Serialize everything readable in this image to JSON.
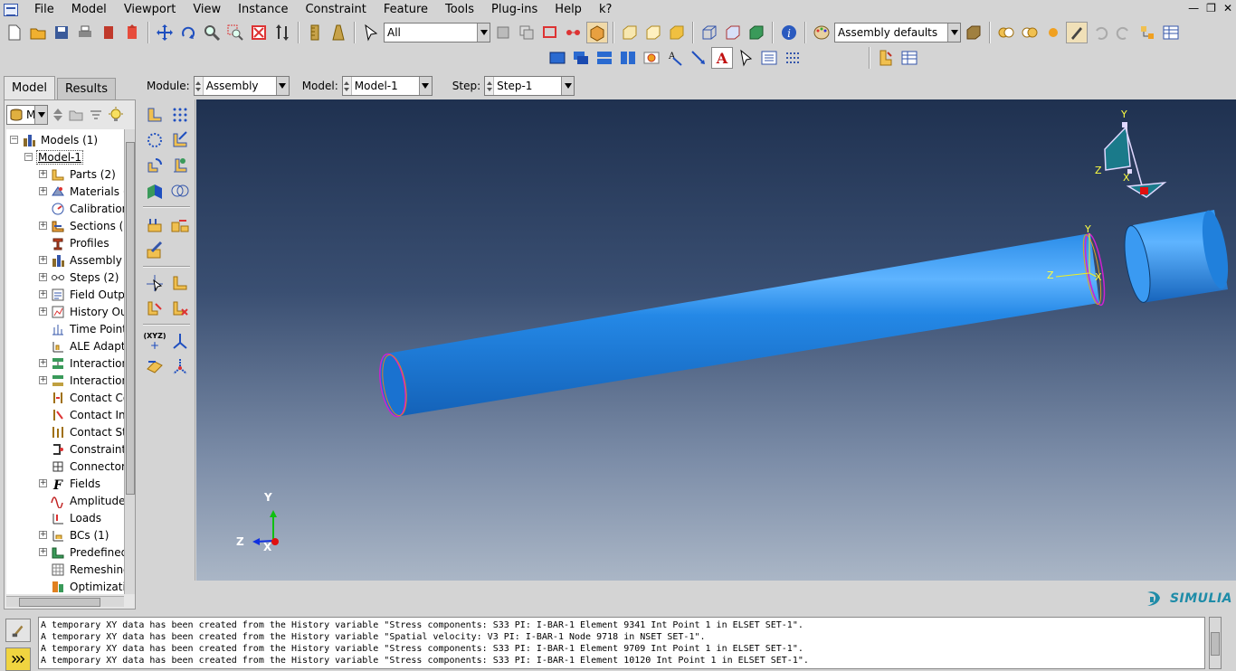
{
  "menu": {
    "items": [
      "File",
      "Model",
      "Viewport",
      "View",
      "Instance",
      "Constraint",
      "Feature",
      "Tools",
      "Plug-ins",
      "Help"
    ],
    "help_pointer": "k?"
  },
  "toolbar": {
    "selection_filter": "All",
    "render_style": "Assembly defaults"
  },
  "context": {
    "module_label": "Module:",
    "module_value": "Assembly",
    "model_label": "Model:",
    "model_value": "Model-1",
    "step_label": "Step:",
    "step_value": "Step-1"
  },
  "tabs": {
    "model": "Model",
    "results": "Results"
  },
  "tree_filter": "M",
  "tree": [
    {
      "label": "Models (1)",
      "icon": "models-icon",
      "expander": "minus",
      "level": 0
    },
    {
      "label": "Model-1",
      "icon": "",
      "expander": "minus",
      "level": 1
    },
    {
      "label": "Parts (2)",
      "icon": "parts-icon",
      "expander": "plus",
      "level": 2
    },
    {
      "label": "Materials (",
      "icon": "materials-icon",
      "expander": "plus",
      "level": 2
    },
    {
      "label": "Calibration",
      "icon": "calibrations-icon",
      "expander": "",
      "level": 2
    },
    {
      "label": "Sections (",
      "icon": "sections-icon",
      "expander": "plus",
      "level": 2
    },
    {
      "label": "Profiles",
      "icon": "profiles-icon",
      "expander": "",
      "level": 2
    },
    {
      "label": "Assembly",
      "icon": "assembly-icon",
      "expander": "plus",
      "level": 2
    },
    {
      "label": "Steps (2)",
      "icon": "steps-icon",
      "expander": "plus",
      "level": 2
    },
    {
      "label": "Field Outp",
      "icon": "field-output-icon",
      "expander": "plus",
      "level": 2
    },
    {
      "label": "History Ou",
      "icon": "history-output-icon",
      "expander": "plus",
      "level": 2
    },
    {
      "label": "Time Point",
      "icon": "time-points-icon",
      "expander": "",
      "level": 2
    },
    {
      "label": "ALE Adapt",
      "icon": "ale-adaptive-icon",
      "expander": "",
      "level": 2
    },
    {
      "label": "Interaction",
      "icon": "interactions-icon",
      "expander": "plus",
      "level": 2
    },
    {
      "label": "Interaction",
      "icon": "interaction-properties-icon",
      "expander": "plus",
      "level": 2
    },
    {
      "label": "Contact Co",
      "icon": "contact-controls-icon",
      "expander": "",
      "level": 2
    },
    {
      "label": "Contact Ini",
      "icon": "contact-initializations-icon",
      "expander": "",
      "level": 2
    },
    {
      "label": "Contact St",
      "icon": "contact-stabilizations-icon",
      "expander": "",
      "level": 2
    },
    {
      "label": "Constraint",
      "icon": "constraints-icon",
      "expander": "",
      "level": 2
    },
    {
      "label": "Connector",
      "icon": "connector-sections-icon",
      "expander": "",
      "level": 2
    },
    {
      "label": "Fields",
      "icon": "fields-icon",
      "expander": "plus",
      "level": 2
    },
    {
      "label": "Amplitudes",
      "icon": "amplitudes-icon",
      "expander": "",
      "level": 2
    },
    {
      "label": "Loads",
      "icon": "loads-icon",
      "expander": "",
      "level": 2
    },
    {
      "label": "BCs (1)",
      "icon": "bcs-icon",
      "expander": "plus",
      "level": 2
    },
    {
      "label": "Predefined",
      "icon": "predefined-fields-icon",
      "expander": "plus",
      "level": 2
    },
    {
      "label": "Remeshing",
      "icon": "remeshing-icon",
      "expander": "",
      "level": 2
    },
    {
      "label": "Optimizatio",
      "icon": "optimization-icon",
      "expander": "",
      "level": 2
    }
  ],
  "viewport": {
    "triad_labels": {
      "y": "Y",
      "z": "Z",
      "x": "X"
    },
    "csys_labels": {
      "y": "Y",
      "z": "Z",
      "x": "X"
    },
    "compass_labels": {
      "y": "Y",
      "z": "Z",
      "x": "X"
    }
  },
  "palette": {
    "coordinate_label": "(XYZ)"
  },
  "brand": "SIMULIA",
  "messages": [
    "A temporary XY data has been created from the History variable \"Stress components: S33 PI: I-BAR-1 Element 9341 Int Point 1 in ELSET SET-1\".",
    "A temporary XY data has been created from the History variable \"Spatial velocity: V3 PI: I-BAR-1 Node 9718 in NSET SET-1\".",
    "A temporary XY data has been created from the History variable \"Stress components: S33 PI: I-BAR-1 Element 9709 Int Point 1 in ELSET SET-1\".",
    "A temporary XY data has been created from the History variable \"Stress components: S33 PI: I-BAR-1 Element 10120 Int Point 1 in ELSET SET-1\"."
  ],
  "colors": {
    "bar": "#1d7fd6",
    "viewport_top": "#1f3150",
    "viewport_bottom": "#aab6c6",
    "brand": "#1f8ca8"
  }
}
